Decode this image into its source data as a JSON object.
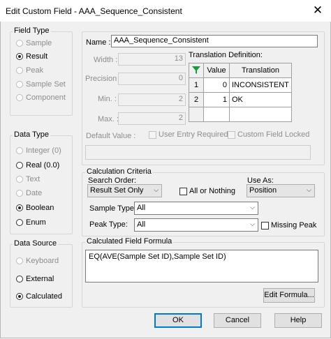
{
  "window": {
    "title": "Edit Custom Field - AAA_Sequence_Consistent",
    "close_glyph": "✕"
  },
  "field_type": {
    "label": "Field Type",
    "options": [
      {
        "label": "Sample",
        "enabled": false,
        "selected": false
      },
      {
        "label": "Result",
        "enabled": true,
        "selected": true
      },
      {
        "label": "Peak",
        "enabled": false,
        "selected": false
      },
      {
        "label": "Sample Set",
        "enabled": false,
        "selected": false
      },
      {
        "label": "Component",
        "enabled": false,
        "selected": false
      }
    ]
  },
  "data_type": {
    "label": "Data Type",
    "options": [
      {
        "label": "Integer (0)",
        "enabled": false,
        "selected": false
      },
      {
        "label": "Real (0.0)",
        "enabled": true,
        "selected": false
      },
      {
        "label": "Text",
        "enabled": false,
        "selected": false
      },
      {
        "label": "Date",
        "enabled": false,
        "selected": false
      },
      {
        "label": "Boolean",
        "enabled": true,
        "selected": true
      },
      {
        "label": "Enum",
        "enabled": true,
        "selected": false
      }
    ]
  },
  "data_source": {
    "label": "Data Source",
    "options": [
      {
        "label": "Keyboard",
        "enabled": false,
        "selected": false
      },
      {
        "label": "External",
        "enabled": true,
        "selected": false
      },
      {
        "label": "Calculated",
        "enabled": true,
        "selected": true
      }
    ]
  },
  "details": {
    "name_label": "Name :",
    "name_value": "AAA_Sequence_Consistent",
    "width_label": "Width :",
    "width_value": "13",
    "precision_label": "Precision :",
    "precision_value": "0",
    "min_label": "Min. :",
    "min_value": "2",
    "max_label": "Max. :",
    "max_value": "2",
    "default_label": "Default Value :",
    "default_value": "",
    "user_entry_label": "User Entry Required",
    "locked_label": "Custom Field Locked"
  },
  "translation": {
    "label": "Translation Definition:",
    "columns": [
      "Value",
      "Translation"
    ],
    "rows": [
      {
        "index": "1",
        "value": "0",
        "translation": "INCONSISTENT"
      },
      {
        "index": "2",
        "value": "1",
        "translation": "OK"
      }
    ]
  },
  "calc": {
    "label": "Calculation Criteria",
    "search_order_label": "Search Order:",
    "search_order_value": "Result Set Only",
    "all_or_nothing_label": "All or Nothing",
    "use_as_label": "Use As:",
    "use_as_value": "Position",
    "sample_type_label": "Sample Type:",
    "sample_type_value": "All",
    "peak_type_label": "Peak Type:",
    "peak_type_value": "All",
    "missing_peak_label": "Missing Peak"
  },
  "formula": {
    "label": "Calculated Field Formula",
    "text": "EQ(AVE(Sample Set ID),Sample Set ID)",
    "edit_button": "Edit Formula..."
  },
  "buttons": {
    "ok": "OK",
    "cancel": "Cancel",
    "help": "Help"
  },
  "colors": {
    "default_button_border": "#0078d7",
    "filter_icon": "#1a9c3e"
  }
}
